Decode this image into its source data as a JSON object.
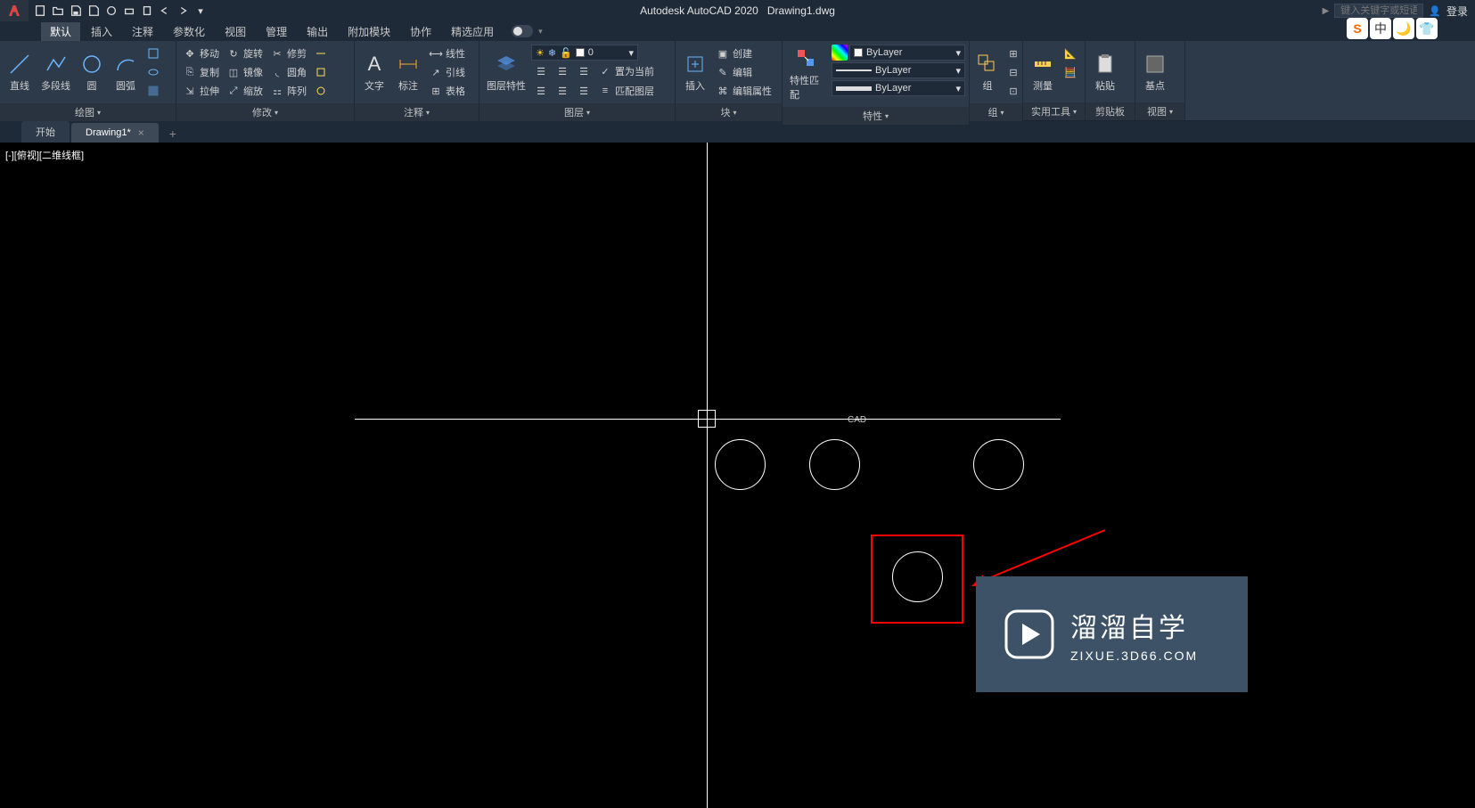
{
  "app": {
    "title": "Autodesk AutoCAD 2020",
    "filename": "Drawing1.dwg"
  },
  "search": {
    "placeholder": "键入关键字或短语"
  },
  "login": {
    "label": "登录"
  },
  "ime": {
    "b1": "S",
    "b2": "中",
    "b3": "☾",
    "b4": "👕"
  },
  "menu": {
    "items": [
      "默认",
      "插入",
      "注释",
      "参数化",
      "视图",
      "管理",
      "输出",
      "附加模块",
      "协作",
      "精选应用"
    ],
    "active": 0
  },
  "ribbon": {
    "draw": {
      "title": "绘图",
      "line": "直线",
      "polyline": "多段线",
      "circle": "圆",
      "arc": "圆弧"
    },
    "modify": {
      "title": "修改",
      "move": "移动",
      "rotate": "旋转",
      "trim": "修剪",
      "copy": "复制",
      "mirror": "镜像",
      "fillet": "圆角",
      "stretch": "拉伸",
      "scale": "缩放",
      "array": "阵列"
    },
    "annotate": {
      "title": "注释",
      "text": "文字",
      "dim": "标注",
      "linear": "线性",
      "leader": "引线",
      "table": "表格"
    },
    "layers": {
      "title": "图层",
      "props": "图层特性",
      "current": "0",
      "setcurrent": "置为当前",
      "match": "匹配图层"
    },
    "block": {
      "title": "块",
      "insert": "插入",
      "create": "创建",
      "edit": "编辑",
      "attr": "编辑属性"
    },
    "properties": {
      "title": "特性",
      "match": "特性匹配",
      "bylayer": "ByLayer"
    },
    "group": {
      "title": "组",
      "label": "组"
    },
    "utilities": {
      "title": "实用工具",
      "measure": "测量"
    },
    "clipboard": {
      "title": "剪贴板",
      "paste": "粘贴"
    },
    "view": {
      "title": "视图",
      "base": "基点"
    }
  },
  "tabs": {
    "start": "开始",
    "drawing": "Drawing1*"
  },
  "viewport": {
    "label": "[-][俯视][二维线框]"
  },
  "canvas_text": "CAD",
  "watermark": {
    "title": "溜溜自学",
    "sub": "ZIXUE.3D66.COM"
  }
}
